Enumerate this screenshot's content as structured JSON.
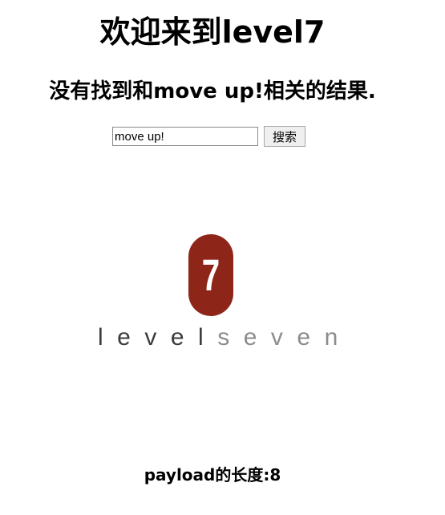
{
  "page": {
    "title": "欢迎来到level7"
  },
  "result": {
    "heading": "没有找到和move up!相关的结果."
  },
  "search": {
    "value": "move up!",
    "button_label": "搜索"
  },
  "logo": {
    "digit": "7",
    "word_level": "level",
    "word_seven": "seven",
    "brand_color": "#8e2519",
    "level_color": "#3c3c3c",
    "seven_color": "#8d8d8d"
  },
  "footer": {
    "payload_length": "payload的长度:8"
  }
}
